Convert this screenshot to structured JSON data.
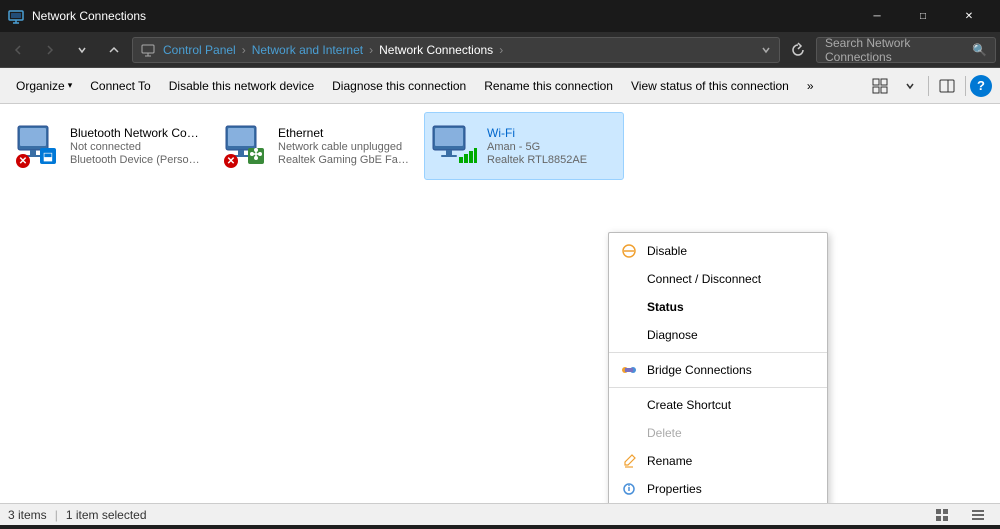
{
  "titleBar": {
    "title": "Network Connections",
    "appIcon": "network-icon",
    "minimizeLabel": "─",
    "maximizeLabel": "□",
    "closeLabel": "✕"
  },
  "navBar": {
    "backBtn": "←",
    "forwardBtn": "→",
    "recentBtn": "▾",
    "upBtn": "↑",
    "breadcrumbs": [
      "Control Panel",
      "Network and Internet",
      "Network Connections"
    ],
    "chevron": "›",
    "dropdownArrow": "▾",
    "refreshTitle": "Refresh",
    "searchPlaceholder": "Search Network Connections",
    "searchIcon": "🔍"
  },
  "toolbar": {
    "organize": "Organize",
    "organizeArrow": "▾",
    "connectTo": "Connect To",
    "disableDevice": "Disable this network device",
    "diagnose": "Diagnose this connection",
    "rename": "Rename this connection",
    "viewStatus": "View status of this connection",
    "moreBtn": "»",
    "viewIcon": "⊞",
    "viewArrow": "▾",
    "windowIcon": "□",
    "helpIcon": "?"
  },
  "networkItems": [
    {
      "id": "bluetooth",
      "name": "Bluetooth Network Connection",
      "status": "Not connected",
      "adapter": "Bluetooth Device (Personal Area ...",
      "iconType": "bluetooth",
      "selected": false
    },
    {
      "id": "ethernet",
      "name": "Ethernet",
      "status": "Network cable unplugged",
      "adapter": "Realtek Gaming GbE Family Contr...",
      "iconType": "ethernet",
      "selected": false
    },
    {
      "id": "wifi",
      "name": "Wi-Fi",
      "status": "Aman - 5G",
      "adapter": "Realtek RTL8852AE",
      "iconType": "wifi",
      "selected": true
    }
  ],
  "contextMenu": {
    "items": [
      {
        "id": "disable",
        "label": "Disable",
        "icon": "disable",
        "bold": false,
        "disabled": false,
        "separator": false
      },
      {
        "id": "connect",
        "label": "Connect / Disconnect",
        "icon": null,
        "bold": false,
        "disabled": false,
        "separator": false
      },
      {
        "id": "status",
        "label": "Status",
        "icon": null,
        "bold": true,
        "disabled": false,
        "separator": false
      },
      {
        "id": "diagnose",
        "label": "Diagnose",
        "icon": null,
        "bold": false,
        "disabled": false,
        "separator": false
      },
      {
        "id": "sep1",
        "label": "",
        "separator": true
      },
      {
        "id": "bridge",
        "label": "Bridge Connections",
        "icon": "bridge",
        "bold": false,
        "disabled": false,
        "separator": false
      },
      {
        "id": "sep2",
        "label": "",
        "separator": true
      },
      {
        "id": "shortcut",
        "label": "Create Shortcut",
        "icon": null,
        "bold": false,
        "disabled": false,
        "separator": false
      },
      {
        "id": "delete",
        "label": "Delete",
        "icon": null,
        "bold": false,
        "disabled": true,
        "separator": false
      },
      {
        "id": "rename",
        "label": "Rename",
        "icon": "rename",
        "bold": false,
        "disabled": false,
        "separator": false
      },
      {
        "id": "properties",
        "label": "Properties",
        "icon": "properties",
        "bold": false,
        "disabled": false,
        "separator": false
      }
    ]
  },
  "statusBar": {
    "itemCount": "3 items",
    "separator": "|",
    "selected": "1 item selected"
  }
}
